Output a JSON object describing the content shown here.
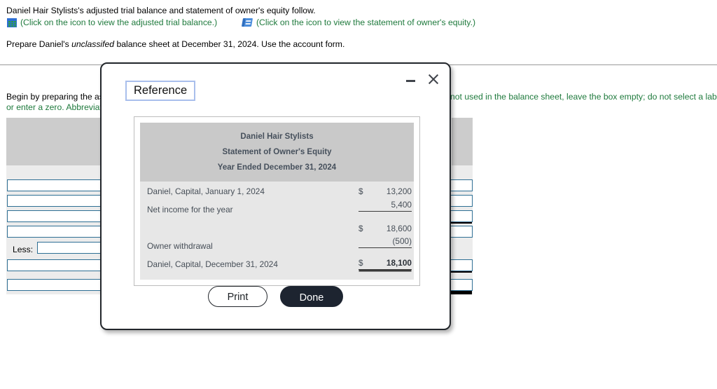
{
  "background": {
    "prompt_line_1": "Daniel Hair Stylists's adjusted trial balance and statement of owner's equity follow.",
    "prompt_line_3_part1": "Prepare Daniel's ",
    "prompt_line_3_italic": "unclassifed",
    "prompt_line_3_part2": " balance sheet at December 31, 2024. Use the account form.",
    "icon_link_1": {
      "icon": "spreadsheet-grid-icon",
      "text": "(Click on the icon to view the adjusted trial balance.)"
    },
    "icon_link_2": {
      "icon": "book-icon",
      "text": "(Click on the icon to view the statement of owner's equity.)"
    },
    "instruction_left": "Begin by preparing the ass",
    "instruction_left_line2": "or enter a zero. Abbreviati",
    "instruction_right": "not used in the balance sheet, leave the box empty; do not select a label",
    "less_label": "Less:"
  },
  "modal": {
    "title": "Reference",
    "minimize_icon": "minimize-icon",
    "close_icon": "close-icon",
    "statement": {
      "header_lines": [
        "Daniel Hair Stylists",
        "Statement of Owner's Equity",
        "Year Ended December 31, 2024"
      ],
      "rows": [
        {
          "label": "Daniel, Capital, January 1, 2024",
          "currency": "$",
          "value": "13,200",
          "rule": "none",
          "bold": false
        },
        {
          "label": "Net income for the year",
          "currency": "",
          "value": "5,400",
          "rule": "single",
          "bold": false
        },
        {
          "label": "",
          "currency": "$",
          "value": "18,600",
          "rule": "none",
          "bold": false
        },
        {
          "label": "Owner withdrawal",
          "currency": "",
          "value": "(500)",
          "rule": "single",
          "bold": false
        },
        {
          "label": "Daniel, Capital, December 31, 2024",
          "currency": "$",
          "value": "18,100",
          "rule": "double",
          "bold": true
        }
      ]
    },
    "print_label": "Print",
    "done_label": "Done"
  },
  "colors": {
    "link_green": "#1f7a3d",
    "modal_border": "#22262b",
    "done_button_bg": "#1d2430",
    "title_outline": "#a9bfec",
    "statement_header_bg": "#c9c9c9",
    "statement_body_bg": "#e7e7e7",
    "input_border": "#2e6f94"
  }
}
